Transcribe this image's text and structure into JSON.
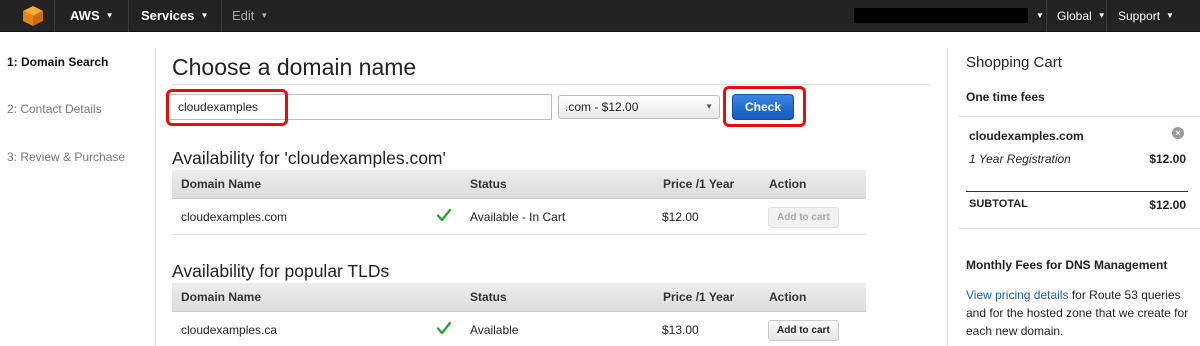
{
  "nav": {
    "brand": "AWS",
    "services": "Services",
    "edit": "Edit",
    "global": "Global",
    "support": "Support"
  },
  "steps": [
    {
      "label": "1: Domain Search",
      "active": true
    },
    {
      "label": "2: Contact Details",
      "active": false
    },
    {
      "label": "3: Review & Purchase",
      "active": false
    }
  ],
  "main": {
    "title": "Choose a domain name",
    "search_value": "cloudexamples",
    "tld_selected": ".com - $12.00",
    "check_label": "Check"
  },
  "table_headers": [
    "Domain Name",
    "Status",
    "Price /1 Year",
    "Action"
  ],
  "availability": {
    "title": "Availability for 'cloudexamples.com'",
    "rows": [
      {
        "domain": "cloudexamples.com",
        "status": "Available - In Cart",
        "price": "$12.00",
        "action": "Add to cart",
        "action_enabled": false
      }
    ]
  },
  "popular": {
    "title": "Availability for popular TLDs",
    "rows": [
      {
        "domain": "cloudexamples.ca",
        "status": "Available",
        "price": "$13.00",
        "action": "Add to cart",
        "action_enabled": true
      }
    ]
  },
  "cart": {
    "title": "Shopping Cart",
    "one_time_label": "One time fees",
    "item_name": "cloudexamples.com",
    "item_line": "1 Year Registration",
    "item_price": "$12.00",
    "subtotal_label": "SUBTOTAL",
    "subtotal_value": "$12.00",
    "monthly_title": "Monthly Fees for DNS Management",
    "monthly_link": "View pricing details",
    "monthly_text": " for Route 53 queries and for the hosted zone that we create for each new domain."
  },
  "colors": {
    "accent_blue": "#1059c1",
    "highlight_red": "#e0110b",
    "check_green": "#2e9e2e",
    "topbar": "#232323"
  }
}
